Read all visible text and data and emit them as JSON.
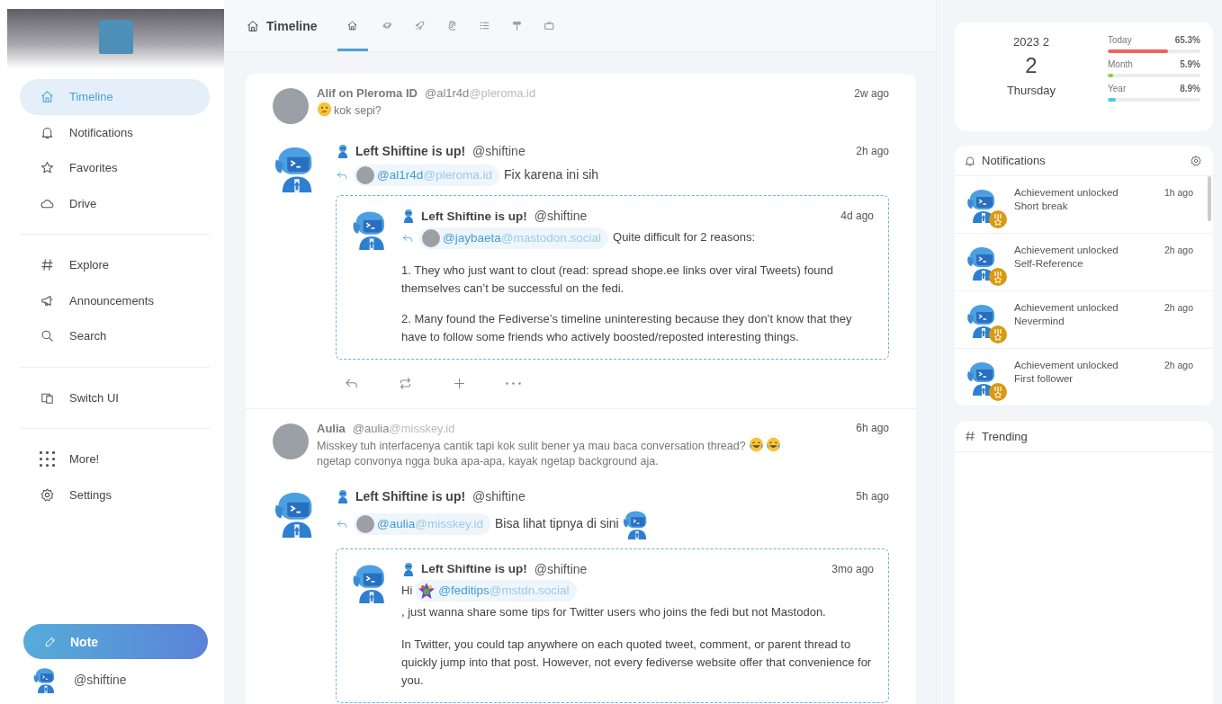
{
  "sidebar": {
    "nav_groups": [
      [
        {
          "label": "Timeline",
          "selected": true
        },
        {
          "label": "Notifications",
          "selected": false
        },
        {
          "label": "Favorites",
          "selected": false
        },
        {
          "label": "Drive",
          "selected": false
        }
      ],
      [
        {
          "label": "Explore",
          "selected": false
        },
        {
          "label": "Announcements",
          "selected": false
        },
        {
          "label": "Search",
          "selected": false
        }
      ],
      [
        {
          "label": "Switch UI",
          "selected": false
        }
      ],
      [
        {
          "label": "More!",
          "selected": false
        },
        {
          "label": "Settings",
          "selected": false
        }
      ]
    ],
    "note_button": "Note",
    "account": "@shiftine"
  },
  "timeline": {
    "title": "Timeline",
    "tabs": [
      {
        "selected": true
      },
      {
        "selected": false
      },
      {
        "selected": false
      },
      {
        "selected": false
      },
      {
        "selected": false
      },
      {
        "selected": false
      },
      {
        "selected": false
      }
    ]
  },
  "feed": [
    {
      "parent": {
        "name": "Alif on Pleroma ID",
        "handle": {
          "user": "@al1r4d",
          "host": "@pleroma.id"
        },
        "time": "2w ago",
        "content": [
          {
            "kind": "thinking-emoji"
          },
          {
            "kind": "text",
            "text": "kok sepi?"
          }
        ]
      },
      "reply": {
        "name": "Left Shiftine is up!",
        "handle": "@shiftine",
        "time": "2h ago",
        "mention": {
          "user": "@al1r4d",
          "host": "@pleroma.id"
        },
        "content": [
          {
            "kind": "text",
            "text": "Fix karena ini sih"
          }
        ],
        "quote": {
          "name": "Left Shiftine is up!",
          "handle": "@shiftine",
          "time": "4d ago",
          "mention": {
            "user": "@jaybaeta",
            "host": "@mastodon.social"
          },
          "paragraphs": [
            [
              {
                "kind": "text",
                "text": "Quite difficult for 2 reasons:"
              }
            ],
            [
              {
                "kind": "text",
                "text": "1. They who just want to clout (read: spread shope.ee links over viral Tweets) found themselves can’t be successful on the fedi."
              }
            ],
            [
              {
                "kind": "text",
                "text": "2. Many found the Fediverse’s timeline uninteresting because they don’t know that they have to follow some friends who actively boosted/reposted interesting things."
              }
            ]
          ]
        }
      },
      "show_actions": true
    },
    {
      "parent": {
        "name": "Aulia",
        "handle": {
          "user": "@aulia",
          "host": "@misskey.id"
        },
        "time": "6h ago",
        "content": [
          {
            "kind": "text",
            "text": "Misskey tuh interfacenya cantik tapi kok sulit bener ya mau baca conversation thread?"
          },
          {
            "kind": "laughing-emoji"
          },
          {
            "kind": "laughing-emoji"
          },
          {
            "kind": "text",
            "text": "ngetap convonya"
          },
          {
            "kind": "text",
            "text": "ngga buka apa-apa, kayak ngetap background aja."
          }
        ]
      },
      "reply": {
        "name": "Left Shiftine is up!",
        "handle": "@shiftine",
        "time": "5h ago",
        "mention": {
          "user": "@aulia",
          "host": "@misskey.id"
        },
        "content": [
          {
            "kind": "text",
            "text": "Bisa lihat tipnya di sini"
          },
          {
            "kind": "custom-emoji"
          }
        ],
        "quote": {
          "name": "Left Shiftine is up!",
          "handle": "@shiftine",
          "time": "3mo ago",
          "paragraphs": [
            [
              {
                "kind": "text",
                "text": "Hi"
              },
              {
                "kind": "mention",
                "user": "@feditips",
                "host": "@mstdn.social"
              },
              {
                "kind": "text",
                "text": ", just wanna share some tips for Twitter users who"
              },
              {
                "kind": "text",
                "text": "joins the fedi but not Mastodon."
              }
            ],
            [
              {
                "kind": "text",
                "text": "In Twitter, you could tap anywhere on each quoted tweet, comment, or parent thread to quickly jump into that post. However, not every fediverse website offer that convenience for you."
              }
            ]
          ]
        }
      },
      "show_actions": false
    }
  ],
  "widgets": {
    "calendar": {
      "year_month": "2023 2",
      "day": "2",
      "weekday": "Thursday",
      "meters": [
        {
          "label": "Today",
          "reading": "65.3%",
          "level": 0.653,
          "color": "#f0645c"
        },
        {
          "label": "Month",
          "reading": "5.9%",
          "level": 0.059,
          "color": "#8ad13a"
        },
        {
          "label": "Year",
          "reading": "8.9%",
          "level": 0.089,
          "color": "#3fd3d6"
        }
      ]
    },
    "notifications": {
      "title": "Notifications",
      "items": [
        {
          "title": "Achievement unlocked",
          "subtitle": "Short break",
          "time": "1h ago"
        },
        {
          "title": "Achievement unlocked",
          "subtitle": "Self-Reference",
          "time": "2h ago"
        },
        {
          "title": "Achievement unlocked",
          "subtitle": "Nevermind",
          "time": "2h ago"
        },
        {
          "title": "Achievement unlocked",
          "subtitle": "First follower",
          "time": "2h ago"
        }
      ]
    },
    "trending": {
      "title": "Trending"
    }
  }
}
